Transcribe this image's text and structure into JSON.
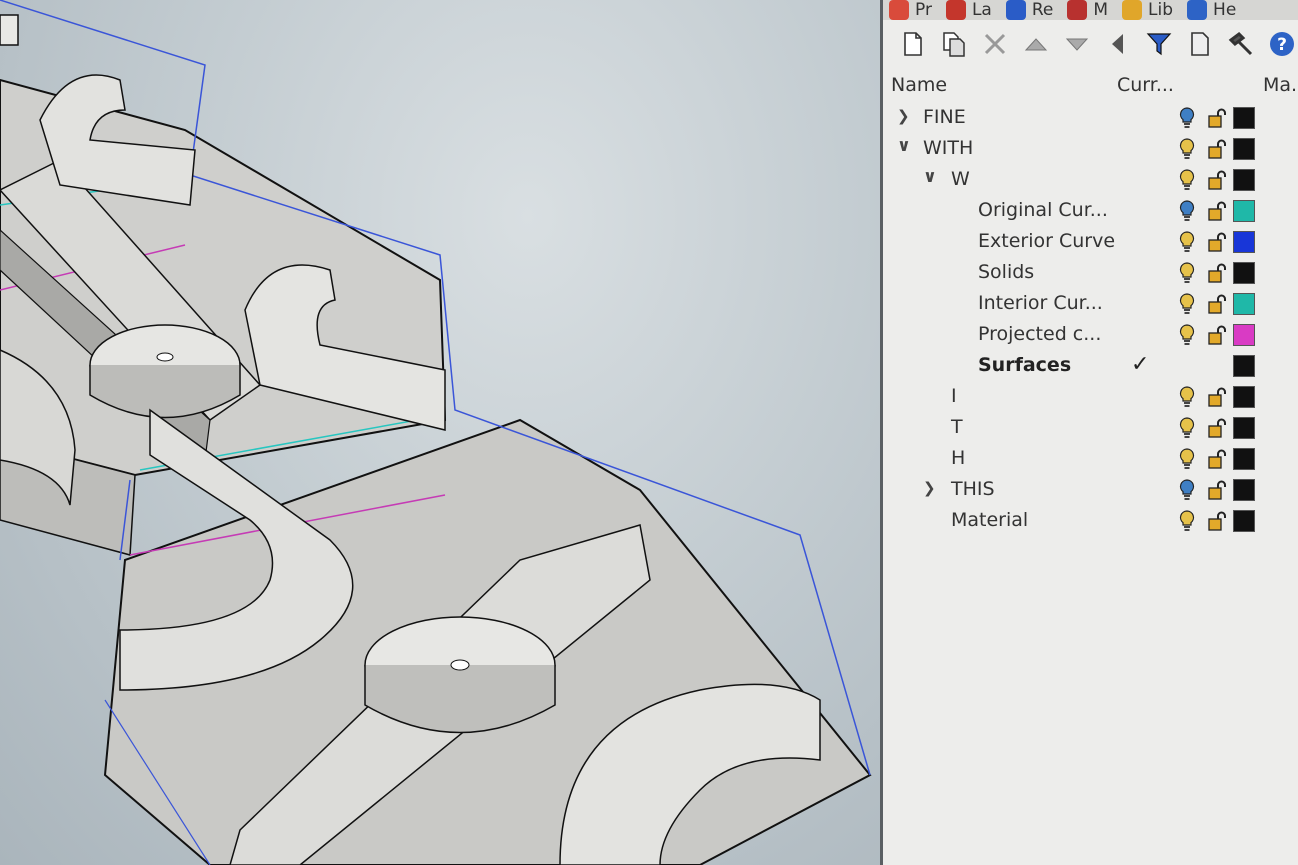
{
  "tabs": [
    {
      "label": "Pr",
      "icon": "color-wheel-icon",
      "color": "#d94b3b"
    },
    {
      "label": "La",
      "icon": "layers-icon",
      "color": "#c4362c"
    },
    {
      "label": "Re",
      "icon": "render-sphere-icon",
      "color": "#2a5cc7"
    },
    {
      "label": "M",
      "icon": "material-brush-icon",
      "color": "#b8312f"
    },
    {
      "label": "Lib",
      "icon": "folder-icon",
      "color": "#e0a62a"
    },
    {
      "label": "He",
      "icon": "help-book-icon",
      "color": "#2d63c6"
    }
  ],
  "toolbar": [
    {
      "name": "new-layer-button",
      "icon": "new-document-icon"
    },
    {
      "name": "new-sublayer-button",
      "icon": "copy-document-icon"
    },
    {
      "name": "delete-layer-button",
      "icon": "delete-x-icon"
    },
    {
      "name": "move-up-button",
      "icon": "triangle-up-icon"
    },
    {
      "name": "move-down-button",
      "icon": "triangle-down-icon"
    },
    {
      "name": "move-to-parent-button",
      "icon": "triangle-left-icon"
    },
    {
      "name": "filter-button",
      "icon": "filter-funnel-icon"
    },
    {
      "name": "layer-states-button",
      "icon": "document-icon"
    },
    {
      "name": "tools-button",
      "icon": "hammer-icon"
    },
    {
      "name": "help-button",
      "icon": "help-circle-icon"
    }
  ],
  "columns": {
    "name": "Name",
    "current": "Curr...",
    "material": "Ma..."
  },
  "layers": [
    {
      "name": "FINE",
      "level": 0,
      "expander": "collapsed",
      "on": true,
      "bulb_color": "#3f7fc4",
      "swatch": "#111111"
    },
    {
      "name": "WITH",
      "level": 0,
      "expander": "expanded",
      "on": true,
      "bulb_color": "#e6c24a",
      "swatch": "#111111"
    },
    {
      "name": "W",
      "level": 1,
      "expander": "expanded",
      "on": true,
      "bulb_color": "#e6c24a",
      "swatch": "#111111"
    },
    {
      "name": "Original Cur...",
      "level": 2,
      "expander": "none",
      "on": true,
      "bulb_color": "#3f7fc4",
      "swatch": "#1fb8a8"
    },
    {
      "name": "Exterior Curve",
      "level": 2,
      "expander": "none",
      "on": true,
      "bulb_color": "#e6c24a",
      "swatch": "#1836d8"
    },
    {
      "name": "Solids",
      "level": 2,
      "expander": "none",
      "on": true,
      "bulb_color": "#e6c24a",
      "swatch": "#111111"
    },
    {
      "name": "Interior Cur...",
      "level": 2,
      "expander": "none",
      "on": true,
      "bulb_color": "#e6c24a",
      "swatch": "#1fb8a8"
    },
    {
      "name": "Projected c...",
      "level": 2,
      "expander": "none",
      "on": true,
      "bulb_color": "#e6c24a",
      "swatch": "#d93bc4"
    },
    {
      "name": "Surfaces",
      "level": 2,
      "expander": "none",
      "current": true,
      "swatch": "#111111"
    },
    {
      "name": "I",
      "level": 1,
      "expander": "none",
      "on": true,
      "bulb_color": "#e6c24a",
      "swatch": "#111111"
    },
    {
      "name": "T",
      "level": 1,
      "expander": "none",
      "on": true,
      "bulb_color": "#e6c24a",
      "swatch": "#111111"
    },
    {
      "name": "H",
      "level": 1,
      "expander": "none",
      "on": true,
      "bulb_color": "#e6c24a",
      "swatch": "#111111"
    },
    {
      "name": "THIS",
      "level": 1,
      "expander": "collapsed",
      "on": true,
      "bulb_color": "#3f7fc4",
      "swatch": "#111111"
    },
    {
      "name": "Material",
      "level": 1,
      "expander": "none",
      "on": true,
      "bulb_color": "#e6c24a",
      "swatch": "#111111"
    }
  ],
  "colors": {
    "lock": "#e2a92a",
    "check": "#222222",
    "viewport_outline": "#3a55d8"
  }
}
